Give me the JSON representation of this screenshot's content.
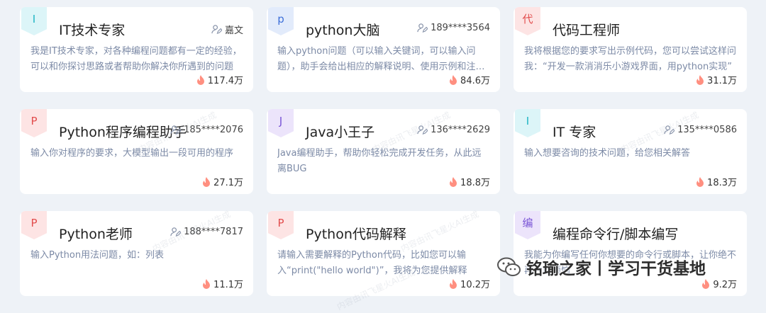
{
  "cards": [
    {
      "badge": "I",
      "badge_bg": "#dcf5f8",
      "badge_fg": "#1fb5c4",
      "title": "IT技术专家",
      "author": "嘉文",
      "desc": "我是IT技术专家，对各种编程问题都有一定的经验，可以和你探讨思路或者帮助你解决你所遇到的问题",
      "count": "117.4万"
    },
    {
      "badge": "p",
      "badge_bg": "#e2ebfb",
      "badge_fg": "#3d6fd9",
      "title": "python大脑",
      "author": "189****3564",
      "desc": "输入python问题（可以输入关键词，可以输入问题），助手会给出相应的解释说明、使用示例和注意事项",
      "count": "84.6万"
    },
    {
      "badge": "代",
      "badge_bg": "#fde4e4",
      "badge_fg": "#e24d4d",
      "title": "代码工程师",
      "author": "",
      "desc": "我将根据您的要求写出示例代码，您可以尝试这样问我：“开发一款消消乐小游戏界面，用python实现”",
      "count": "31.1万"
    },
    {
      "badge": "P",
      "badge_bg": "#fde4e4",
      "badge_fg": "#e24d4d",
      "title": "Python程序编程助手",
      "author": "185****2076",
      "desc": "输入你对程序的要求，大模型输出一段可用的程序",
      "count": "27.1万"
    },
    {
      "badge": "J",
      "badge_bg": "#ece4fb",
      "badge_fg": "#7a55d6",
      "title": "Java小王子",
      "author": "136****2629",
      "desc": "Java编程助手，帮助你轻松完成开发任务，从此远离BUG",
      "count": "18.8万"
    },
    {
      "badge": "I",
      "badge_bg": "#dcf5f8",
      "badge_fg": "#1fb5c4",
      "title": "IT 专家",
      "author": "135****0586",
      "desc": "输入想要咨询的技术问题，给您相关解答",
      "count": "18.3万"
    },
    {
      "badge": "P",
      "badge_bg": "#fde4e4",
      "badge_fg": "#e24d4d",
      "title": "Python老师",
      "author": "188****7817",
      "desc": "输入Python用法问题，如：列表",
      "count": "11.1万"
    },
    {
      "badge": "P",
      "badge_bg": "#fde4e4",
      "badge_fg": "#e24d4d",
      "title": "Python代码解释",
      "author": "",
      "desc": "请输入需要解释的Python代码，比如您可以输入“print(\"hello world\")”，我将为您提供解释",
      "count": "10.2万"
    },
    {
      "badge": "编",
      "badge_bg": "#ece4fb",
      "badge_fg": "#7a55d6",
      "title": "编程命令行/脚本编写",
      "author": "",
      "desc": "我能为你编写任何你想要的命令行或脚本，让你绝不再为此烦恼",
      "count": "9.2万"
    }
  ],
  "watermark": {
    "text": "铭瑜之家丨学习干货基地"
  },
  "faint_watermark": "内容由讯飞星火AI生成"
}
